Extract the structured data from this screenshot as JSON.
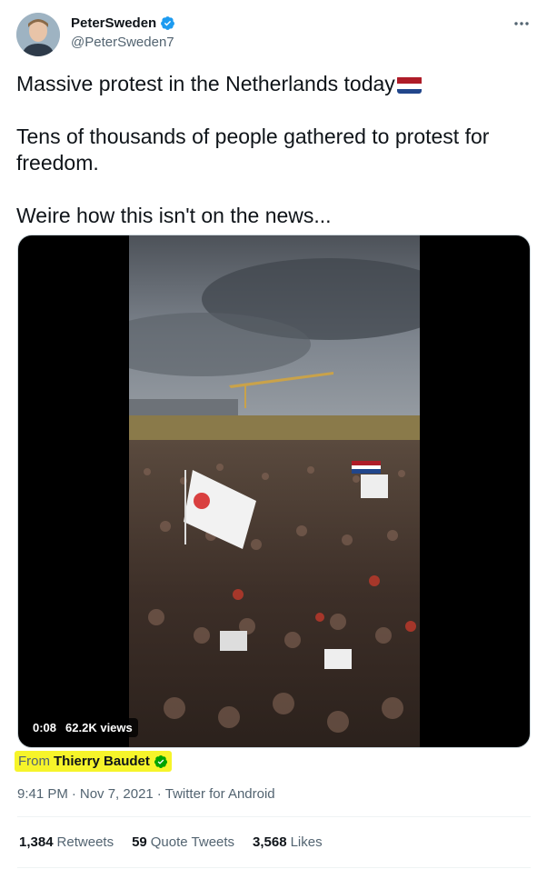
{
  "author": {
    "display_name": "PeterSweden",
    "handle": "@PeterSweden7",
    "verified_icon": "verified-badge-icon"
  },
  "tweet": {
    "line1": "Massive protest in the Netherlands today",
    "flag_icon": "netherlands-flag-icon",
    "line2": "Tens of thousands of people gathered to protest for freedom.",
    "line3": "Weire how this isn't on the news..."
  },
  "video": {
    "duration": "0:08",
    "views": "62.2K views"
  },
  "attribution": {
    "from_label": "From",
    "source_name": "Thierry Baudet",
    "highlight_color": "#f6f42a"
  },
  "meta": {
    "time": "9:41 PM",
    "separator1": "·",
    "date": "Nov 7, 2021",
    "separator2": "·",
    "client": "Twitter for Android"
  },
  "stats": {
    "retweets_count": "1,384",
    "retweets_label": "Retweets",
    "quotes_count": "59",
    "quotes_label": "Quote Tweets",
    "likes_count": "3,568",
    "likes_label": "Likes"
  },
  "colors": {
    "accent": "#1d9bf0",
    "verified_gold": "#00a300"
  }
}
